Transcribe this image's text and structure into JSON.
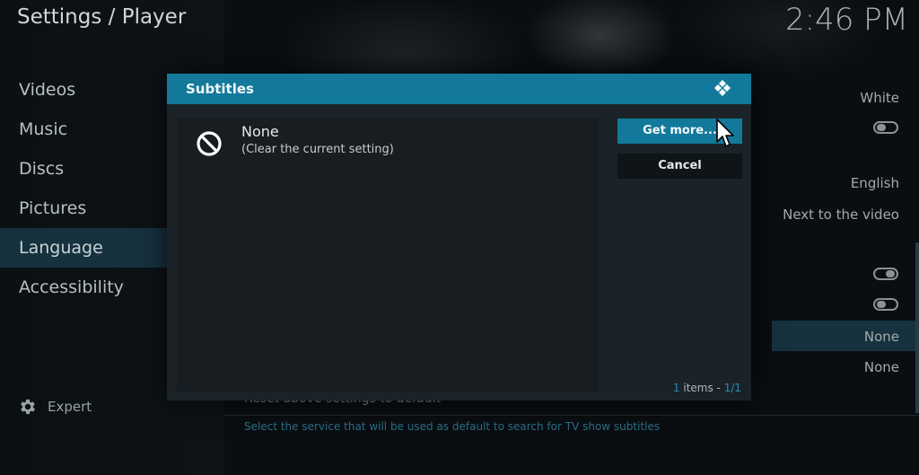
{
  "header": {
    "breadcrumb": "Settings / Player",
    "clock": "2:46 PM"
  },
  "nav": {
    "items": [
      {
        "label": "Videos",
        "active": false
      },
      {
        "label": "Music",
        "active": false
      },
      {
        "label": "Discs",
        "active": false
      },
      {
        "label": "Pictures",
        "active": false
      },
      {
        "label": "Language",
        "active": true
      },
      {
        "label": "Accessibility",
        "active": false
      }
    ],
    "expert_label": "Expert"
  },
  "background_settings": {
    "values": [
      "White",
      "English",
      "Next to the video",
      "None",
      "None"
    ],
    "reset_label": "Reset above settings to default",
    "hint": "Select the service that will be used as default to search for TV show subtitles"
  },
  "dialog": {
    "title": "Subtitles",
    "list": [
      {
        "title": "None",
        "subtitle": "(Clear the current setting)",
        "icon": "no-entry-icon"
      }
    ],
    "buttons": {
      "get_more": "Get more...",
      "cancel": "Cancel"
    },
    "count": {
      "number": "1",
      "label": " items - ",
      "pages": "1/1"
    }
  },
  "colors": {
    "accent": "#12799b",
    "highlight": "#16323e"
  }
}
